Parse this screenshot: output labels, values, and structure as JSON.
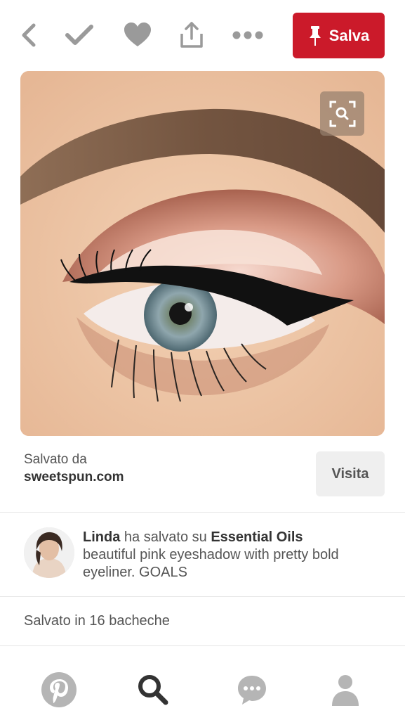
{
  "toolbar": {
    "icons": [
      "back-icon",
      "check-icon",
      "heart-icon",
      "share-icon",
      "more-icon"
    ],
    "save_label": "Salva"
  },
  "source": {
    "saved_from_label": "Salvato da",
    "domain": "sweetspun.com",
    "visit_label": "Visita"
  },
  "activity": {
    "user": "Linda",
    "action": "ha salvato su",
    "board": "Essential Oils",
    "description": "beautiful pink eyeshadow with pretty bold eyeliner. GOALS"
  },
  "boards_count_text": "Salvato in 16 bacheche",
  "bottom_nav": {
    "items": [
      "pinterest-icon",
      "search-icon",
      "messages-icon",
      "profile-icon"
    ],
    "active": "search-icon"
  },
  "colors": {
    "accent": "#cb1a2a",
    "icon_gray": "#9a9a9a",
    "text": "#333333"
  }
}
